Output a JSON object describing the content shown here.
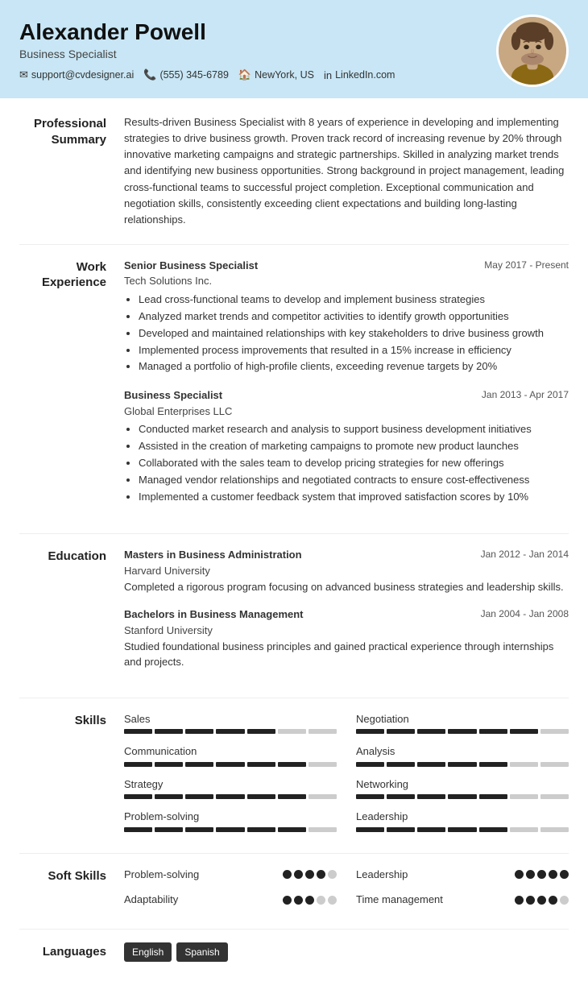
{
  "header": {
    "name": "Alexander Powell",
    "title": "Business Specialist",
    "contact": {
      "email": "support@cvdesigner.ai",
      "phone": "(555) 345-6789",
      "location": "NewYork, US",
      "linkedin": "LinkedIn.com"
    }
  },
  "sections": {
    "summary": {
      "label": "Professional\nSummary",
      "text": "Results-driven Business Specialist with 8 years of experience in developing and implementing strategies to drive business growth. Proven track record of increasing revenue by 20% through innovative marketing campaigns and strategic partnerships. Skilled in analyzing market trends and identifying new business opportunities. Strong background in project management, leading cross-functional teams to successful project completion. Exceptional communication and negotiation skills, consistently exceeding client expectations and building long-lasting relationships."
    },
    "work_experience": {
      "label": "Work\nExperience",
      "jobs": [
        {
          "title": "Senior Business Specialist",
          "company": "Tech Solutions Inc.",
          "date": "May 2017 - Present",
          "bullets": [
            "Lead cross-functional teams to develop and implement business strategies",
            "Analyzed market trends and competitor activities to identify growth opportunities",
            "Developed and maintained relationships with key stakeholders to drive business growth",
            "Implemented process improvements that resulted in a 15% increase in efficiency",
            "Managed a portfolio of high-profile clients, exceeding revenue targets by 20%"
          ]
        },
        {
          "title": "Business Specialist",
          "company": "Global Enterprises LLC",
          "date": "Jan 2013 - Apr 2017",
          "bullets": [
            "Conducted market research and analysis to support business development initiatives",
            "Assisted in the creation of marketing campaigns to promote new product launches",
            "Collaborated with the sales team to develop pricing strategies for new offerings",
            "Managed vendor relationships and negotiated contracts to ensure cost-effectiveness",
            "Implemented a customer feedback system that improved satisfaction scores by 10%"
          ]
        }
      ]
    },
    "education": {
      "label": "Education",
      "items": [
        {
          "degree": "Masters in Business Administration",
          "school": "Harvard University",
          "date": "Jan 2012 - Jan 2014",
          "desc": "Completed a rigorous program focusing on advanced business strategies and leadership skills."
        },
        {
          "degree": "Bachelors in Business Management",
          "school": "Stanford University",
          "date": "Jan 2004 - Jan 2008",
          "desc": "Studied foundational business principles and gained practical experience through internships and projects."
        }
      ]
    },
    "skills": {
      "label": "Skills",
      "items": [
        {
          "name": "Sales",
          "level": 75
        },
        {
          "name": "Negotiation",
          "level": 80
        },
        {
          "name": "Communication",
          "level": 90
        },
        {
          "name": "Analysis",
          "level": 70
        },
        {
          "name": "Strategy",
          "level": 85
        },
        {
          "name": "Networking",
          "level": 75
        },
        {
          "name": "Problem-solving",
          "level": 80
        },
        {
          "name": "Leadership",
          "level": 70
        }
      ]
    },
    "soft_skills": {
      "label": "Soft Skills",
      "items": [
        {
          "name": "Problem-solving",
          "filled": 4,
          "total": 5
        },
        {
          "name": "Leadership",
          "filled": 5,
          "total": 5
        },
        {
          "name": "Adaptability",
          "filled": 3,
          "total": 5
        },
        {
          "name": "Time management",
          "filled": 4,
          "total": 5
        }
      ]
    },
    "languages": {
      "label": "Languages",
      "items": [
        "English",
        "Spanish"
      ]
    }
  }
}
